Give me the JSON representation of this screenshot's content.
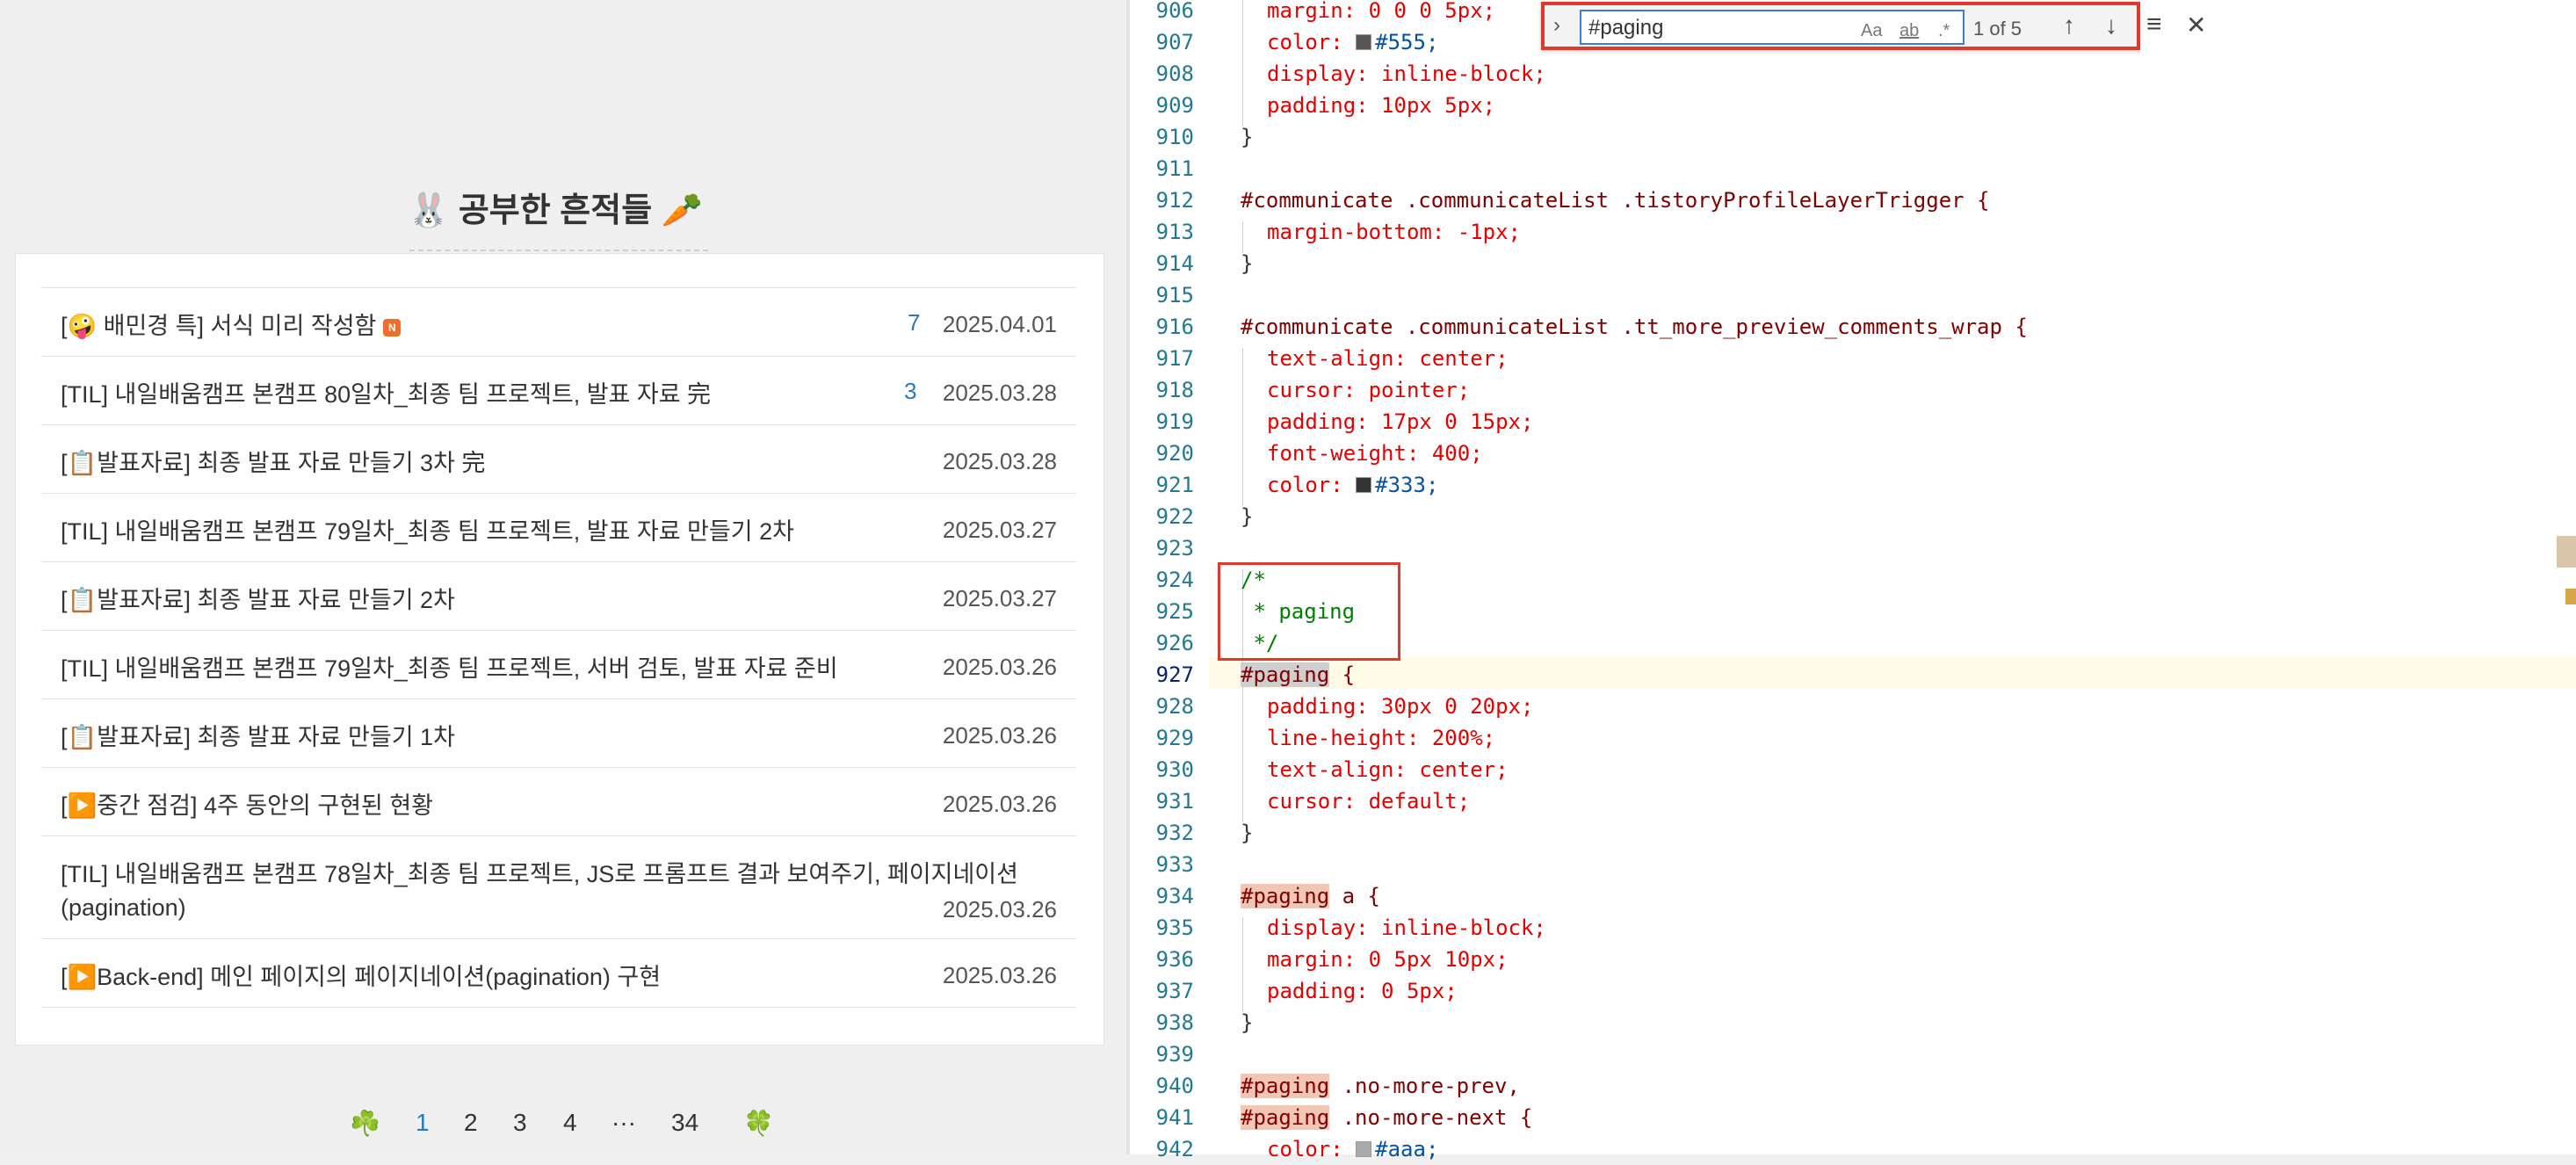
{
  "blog": {
    "title": "🐰 공부한 흔적들 🥕",
    "posts": [
      {
        "title": "[🤪 배민경 특] 서식 미리 작성함",
        "badge": "N",
        "count": "7",
        "date": "2025.04.01"
      },
      {
        "title": "[TIL] 내일배움캠프 본캠프 80일차_최종 팀 프로젝트, 발표 자료 完",
        "count": "3",
        "date": "2025.03.28"
      },
      {
        "title": "[📋발표자료] 최종 발표 자료 만들기 3차 完",
        "date": "2025.03.28"
      },
      {
        "title": "[TIL] 내일배움캠프 본캠프 79일차_최종 팀 프로젝트, 발표 자료 만들기 2차",
        "date": "2025.03.27"
      },
      {
        "title": "[📋발표자료] 최종 발표 자료 만들기 2차",
        "date": "2025.03.27"
      },
      {
        "title": "[TIL] 내일배움캠프 본캠프 79일차_최종 팀 프로젝트, 서버 검토, 발표 자료 준비",
        "date": "2025.03.26"
      },
      {
        "title": "[📋발표자료] 최종 발표 자료 만들기 1차",
        "date": "2025.03.26"
      },
      {
        "title": "[▶️중간 점검] 4주 동안의 구현된 현황",
        "date": "2025.03.26"
      },
      {
        "title": "[TIL] 내일배움캠프 본캠프 78일차_최종 팀 프로젝트, JS로 프롬프트 결과 보여주기, 페이지네이션(pagination)",
        "date": "2025.03.26"
      },
      {
        "title": "[▶️Back-end] 메인 페이지의 페이지네이션(pagination) 구현",
        "date": "2025.03.26"
      }
    ],
    "pager": {
      "prev_icon": "☘️",
      "pages": [
        "1",
        "2",
        "3",
        "4",
        "···",
        "34"
      ],
      "current": "1",
      "next_icon": "🍀"
    }
  },
  "editor": {
    "find": {
      "query": "#paging",
      "match_case": "Aa",
      "whole_word": "ab",
      "regex": ".*",
      "result": "1 of 5"
    },
    "line_numbers": [
      "906",
      "907",
      "908",
      "909",
      "910",
      "911",
      "912",
      "913",
      "914",
      "915",
      "916",
      "917",
      "918",
      "919",
      "920",
      "921",
      "922",
      "923",
      "924",
      "925",
      "926",
      "927",
      "928",
      "929",
      "930",
      "931",
      "932",
      "933",
      "934",
      "935",
      "936",
      "937",
      "938",
      "939",
      "940",
      "941",
      "942"
    ],
    "code": {
      "l906": "margin: 0 0 0 5px;",
      "l907a": "color: ",
      "l907b": "#555;",
      "l908": "display: inline-block;",
      "l909": "padding: 10px 5px;",
      "l910": "}",
      "l912": "#communicate .communicateList .tistoryProfileLayerTrigger {",
      "l913": "margin-bottom: -1px;",
      "l914": "}",
      "l916": "#communicate .communicateList .tt_more_preview_comments_wrap {",
      "l917": "text-align: center;",
      "l918": "cursor: pointer;",
      "l919": "padding: 17px 0 15px;",
      "l920": "font-weight: 400;",
      "l921a": "color: ",
      "l921b": "#333;",
      "l922": "}",
      "l924": "/*",
      "l925": " * paging",
      "l926": " */",
      "l927a": "#paging",
      "l927b": " {",
      "l928": "padding: 30px 0 20px;",
      "l929": "line-height: 200%;",
      "l930": "text-align: center;",
      "l931": "cursor: default;",
      "l932": "}",
      "l934a": "#paging",
      "l934b": " a {",
      "l935": "display: inline-block;",
      "l936": "margin: 0 5px 10px;",
      "l937": "padding: 0 5px;",
      "l938": "}",
      "l940a": "#paging",
      "l940b": " .no-more-prev,",
      "l941a": "#paging",
      "l941b": " .no-more-next {",
      "l942a": "color: ",
      "l942b": "#aaa;"
    }
  },
  "colors": {
    "link": "#2a7ab8",
    "highlight": "#f2c6b5",
    "annotation": "#e03a2f"
  }
}
